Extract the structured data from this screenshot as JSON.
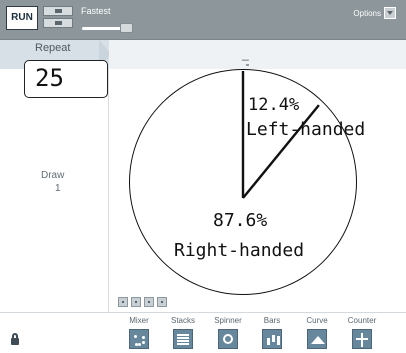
{
  "toolbar": {
    "run_label": "RUN",
    "speed_label": "Fastest",
    "options_label": "Options",
    "speed_setting": 0.92
  },
  "left_panel": {
    "repeat_label": "Repeat",
    "repeat_value": "25",
    "draw_label": "Draw",
    "draw_value": "1"
  },
  "main_header": {
    "measure_label": "_"
  },
  "spinner": {
    "sections": [
      {
        "percent_label": "12.4%",
        "name": "Left-handed",
        "value": 12.4
      },
      {
        "percent_label": "87.6%",
        "name": "Right-handed",
        "value": 87.6
      }
    ]
  },
  "device_bar": {
    "items": [
      {
        "label": "Mixer",
        "icon": "mixer-icon"
      },
      {
        "label": "Stacks",
        "icon": "stacks-icon"
      },
      {
        "label": "Spinner",
        "icon": "spinner-icon"
      },
      {
        "label": "Bars",
        "icon": "bars-icon"
      },
      {
        "label": "Curve",
        "icon": "curve-icon"
      },
      {
        "label": "Counter",
        "icon": "counter-icon"
      }
    ]
  },
  "colors": {
    "toolbar": "#8c969b",
    "panel_header": "#d7e0e6",
    "device_blue": "#66879c",
    "text_muted": "#5f6c75",
    "outline": "#111111"
  }
}
